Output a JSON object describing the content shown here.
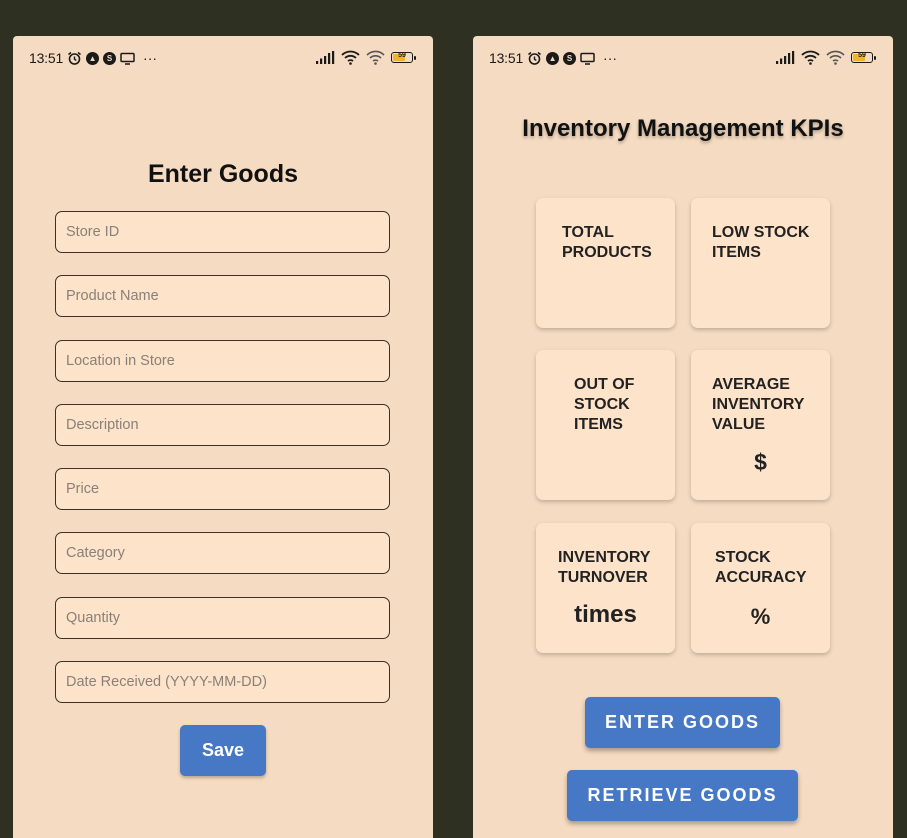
{
  "left_screen": {
    "status_bar": {
      "time": "13:51",
      "battery": "59"
    },
    "title": "Enter Goods",
    "fields": [
      {
        "placeholder": "Store ID",
        "value": ""
      },
      {
        "placeholder": "Product Name",
        "value": ""
      },
      {
        "placeholder": "Location in Store",
        "value": ""
      },
      {
        "placeholder": "Description",
        "value": ""
      },
      {
        "placeholder": "Price",
        "value": ""
      },
      {
        "placeholder": "Category",
        "value": ""
      },
      {
        "placeholder": "Quantity",
        "value": ""
      },
      {
        "placeholder": "Date Received (YYYY-MM-DD)",
        "value": ""
      }
    ],
    "save_label": "Save"
  },
  "right_screen": {
    "status_bar": {
      "time": "13:51",
      "battery": "59"
    },
    "title": "Inventory Management KPIs",
    "cards": {
      "total_products": {
        "label": "TOTAL\nPRODUCTS"
      },
      "low_stock": {
        "label": "LOW STOCK\nITEMS"
      },
      "out_of_stock": {
        "label": "OUT OF\nSTOCK\nITEMS"
      },
      "avg_value": {
        "label": "AVERAGE\nINVENTORY\nVALUE",
        "unit": "$"
      },
      "turnover": {
        "label": "INVENTORY\nTURNOVER",
        "unit": "times"
      },
      "accuracy": {
        "label": "STOCK\nACCURACY",
        "unit": "%"
      }
    },
    "enter_goods_label": "ENTER GOODS",
    "retrieve_goods_label": "RETRIEVE GOODS"
  },
  "colors": {
    "background": "#2e3122",
    "screen": "#f5dbc1",
    "card": "#fde3c9",
    "button": "#4778c6"
  }
}
